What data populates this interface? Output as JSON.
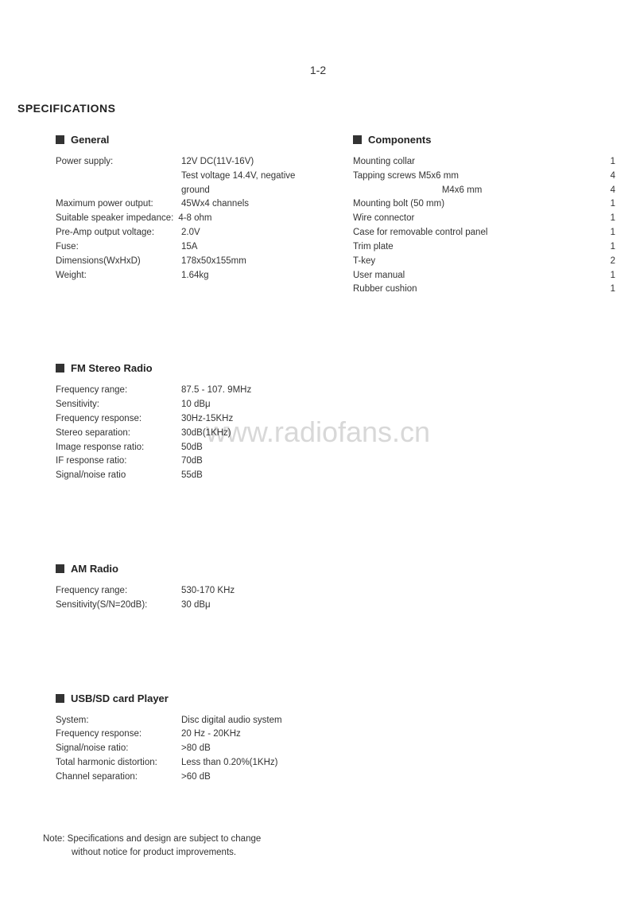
{
  "page_number": "1-2",
  "main_title": "SPECIFICATIONS",
  "watermark": "www.radiofans.cn",
  "sections": {
    "general": {
      "title": "General",
      "rows": [
        {
          "label": "Power supply:",
          "value": "12V DC(11V-16V)"
        },
        {
          "label": "",
          "value": "Test voltage 14.4V, negative ground"
        },
        {
          "label": "Maximum power output:",
          "value": "45Wx4 channels"
        },
        {
          "label": "Suitable speaker impedance:",
          "value": "4-8 ohm"
        },
        {
          "label": "Pre-Amp output voltage:",
          "value": "2.0V"
        },
        {
          "label": "Fuse:",
          "value": "15A"
        },
        {
          "label": "Dimensions(WxHxD)",
          "value": "178x50x155mm"
        },
        {
          "label": "Weight:",
          "value": "1.64kg"
        }
      ]
    },
    "components": {
      "title": "Components",
      "rows": [
        {
          "name": "Mounting collar",
          "qty": "1"
        },
        {
          "name": "Tapping screws M5x6 mm",
          "qty": "4"
        },
        {
          "name": "                                   M4x6 mm",
          "qty": "4"
        },
        {
          "name": "Mounting bolt (50 mm)",
          "qty": "1"
        },
        {
          "name": "Wire connector",
          "qty": "1"
        },
        {
          "name": "Case for removable control panel",
          "qty": "1"
        },
        {
          "name": "Trim plate",
          "qty": "1"
        },
        {
          "name": "T-key",
          "qty": "2"
        },
        {
          "name": "User manual",
          "qty": "1"
        },
        {
          "name": "Rubber cushion",
          "qty": "1"
        }
      ]
    },
    "fm": {
      "title": "FM Stereo Radio",
      "rows": [
        {
          "label": "Frequency range:",
          "value": "87.5 - 107. 9MHz"
        },
        {
          "label": "Sensitivity:",
          "value": "10 dBμ"
        },
        {
          "label": "Frequency response:",
          "value": "30Hz-15KHz"
        },
        {
          "label": "Stereo separation:",
          "value": "30dB(1KHz)"
        },
        {
          "label": "Image response ratio:",
          "value": "50dB"
        },
        {
          "label": "IF response ratio:",
          "value": "70dB"
        },
        {
          "label": "Signal/noise ratio",
          "value": "55dB"
        }
      ]
    },
    "am": {
      "title": "AM Radio",
      "rows": [
        {
          "label": "Frequency range:",
          "value": "530-170 KHz"
        },
        {
          "label": "Sensitivity(S/N=20dB):",
          "value": "30 dBμ"
        }
      ]
    },
    "usb": {
      "title": "USB/SD  card   Player",
      "rows": [
        {
          "label": "System:",
          "value": "Disc digital audio system"
        },
        {
          "label": "Frequency response:",
          "value": "20 Hz - 20KHz"
        },
        {
          "label": "Signal/noise ratio:",
          "value": ">80 dB"
        },
        {
          "label": "Total harmonic distortion:",
          "value": "Less than 0.20%(1KHz)"
        },
        {
          "label": "Channel separation:",
          "value": ">60 dB"
        }
      ]
    }
  },
  "note_line1": "Note: Specifications and design are subject to change",
  "note_line2": "without notice for product improvements."
}
